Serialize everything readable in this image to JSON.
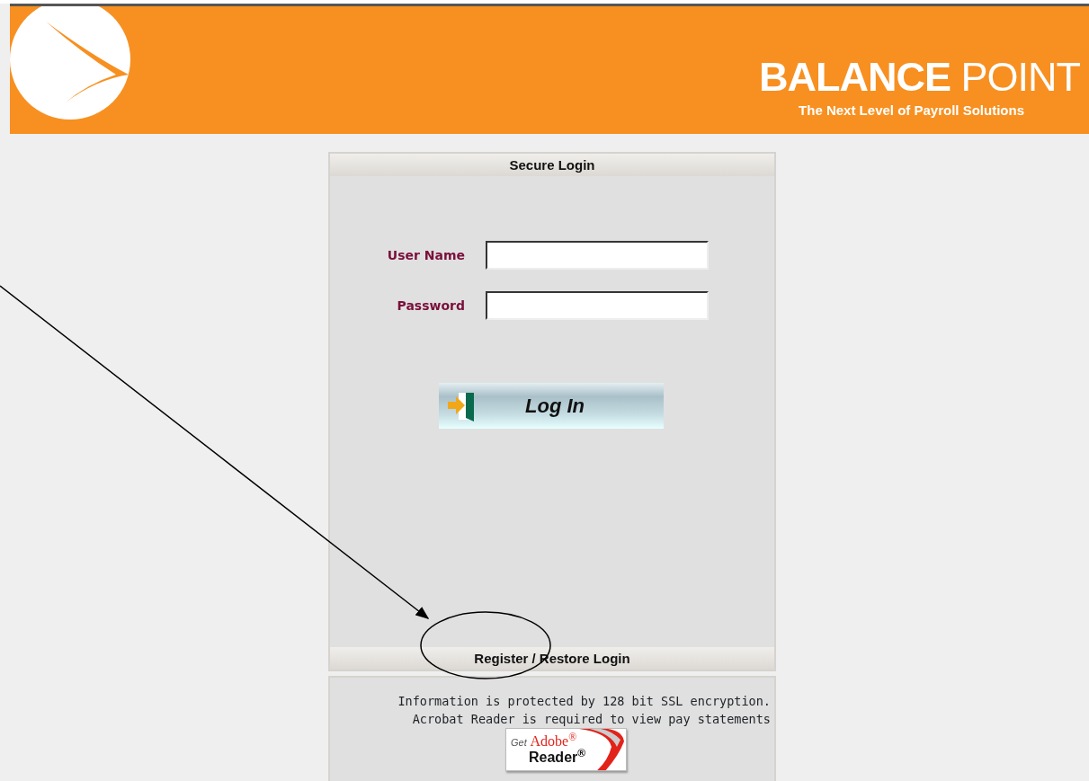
{
  "header": {
    "brand_bold": "BALANCE",
    "brand_light": "POINT",
    "tagline": "The Next Level of Payroll Solutions"
  },
  "login": {
    "title": "Secure Login",
    "fields": [
      {
        "label": "User Name"
      },
      {
        "label": "Password"
      }
    ],
    "button": "Log In",
    "register_link": "Register / Restore Login"
  },
  "info": {
    "lines": [
      "Information is protected by 128 bit SSL encryption.",
      "Acrobat Reader is required to view pay statements"
    ],
    "badge": {
      "prefix": "Get",
      "brand": "Adobe$^{®}$",
      "product": "Reader$^{®}$"
    }
  }
}
